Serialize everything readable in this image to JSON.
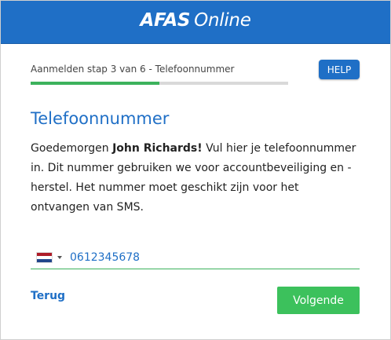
{
  "header": {
    "brand": "AFAS",
    "brand_sub": "Online",
    "color": "#1f6fc6"
  },
  "step": {
    "text": "Aanmelden stap 3 van 6 - Telefoonnummer",
    "current": 3,
    "total": 6,
    "progress_fraction": 0.5,
    "progress_color": "#3cb25c"
  },
  "help_button": {
    "label": "HELP"
  },
  "title": "Telefoonnummer",
  "intro": {
    "greeting": "Goedemorgen ",
    "name": "John Richards!",
    "text": " Vul hier je telefoonnummer in. Dit nummer gebruiken we voor accountbeveiliging en -herstel. Het nummer moet geschikt zijn voor het ontvangen van SMS."
  },
  "phone": {
    "country_icon": "flag-netherlands-icon",
    "value": "0612345678"
  },
  "back_link": {
    "label": "Terug"
  },
  "next_button": {
    "label": "Volgende",
    "color": "#3cc15c"
  }
}
